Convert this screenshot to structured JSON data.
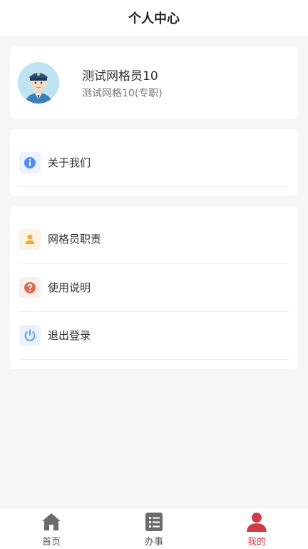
{
  "header": {
    "title": "个人中心"
  },
  "profile": {
    "name": "测试网格员10",
    "role": "测试网格10(专职)",
    "avatar_icon": "police-officer-avatar"
  },
  "menu_group_1": [
    {
      "label": "关于我们",
      "icon": "info-icon",
      "icon_color": "#4f8ff0",
      "icon_bg": "#eaf2fd"
    }
  ],
  "menu_group_2": [
    {
      "label": "网格员职责",
      "icon": "user-icon",
      "icon_color": "#f2a93b",
      "icon_bg": "#fdf3e4"
    },
    {
      "label": "使用说明",
      "icon": "question-icon",
      "icon_color": "#e06a4f",
      "icon_bg": "#fceeea"
    },
    {
      "label": "退出登录",
      "icon": "power-icon",
      "icon_color": "#5a9bf0",
      "icon_bg": "#eaf2fd"
    }
  ],
  "tabbar": [
    {
      "label": "首页",
      "icon": "home-icon",
      "active": false
    },
    {
      "label": "办事",
      "icon": "list-icon",
      "active": false
    },
    {
      "label": "我的",
      "icon": "person-icon",
      "active": true
    }
  ],
  "colors": {
    "accent": "#cf3b47",
    "tab_inactive": "#666666"
  }
}
